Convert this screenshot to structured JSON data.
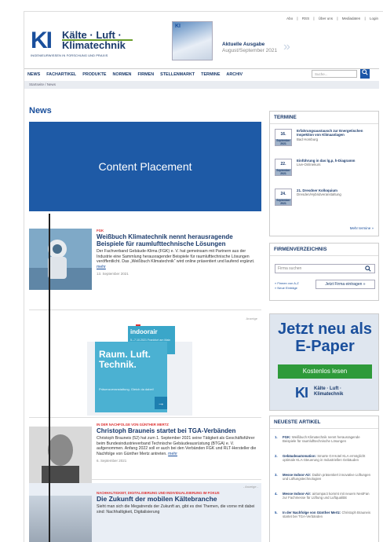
{
  "header": {
    "top_links": [
      "Abo",
      "RSS",
      "Über uns",
      "Mediadaten",
      "Login"
    ],
    "logo": {
      "ki": "KI",
      "line1": "Kälte · Luft ·",
      "line2": "Klimatechnik",
      "tagline": "INGENIEURWISSEN IN FORSCHUNG UND PRAXIS"
    },
    "magazine_title": "KI",
    "issue_label": "Aktuelle Ausgabe",
    "issue_date": "August/September 2021",
    "issue_arrow": "»"
  },
  "nav": {
    "items": [
      "NEWS",
      "FACHARTIKEL",
      "PRODUKTE",
      "NORMEN",
      "FIRMEN",
      "STELLENMARKT",
      "TERMINE",
      "ARCHIV"
    ],
    "search_placeholder": "Suche...",
    "search_icon": "search-icon"
  },
  "breadcrumb": "Startseite / News",
  "main": {
    "heading": "News",
    "content_placement": "Content Placement",
    "articles": [
      {
        "kicker": "FGK",
        "title": "Weißbuch Klimatechnik nennt herausragende Beispiele für raumlufttechnische Lösungen",
        "text": "Der Fachverband Gebäude-Klima (FGK) e. V. hat gemeinsam mit Partnern aus der Industrie eine Sammlung herausragender Beispiele für raumlufttechnische Lösungen veröffentlicht. Das „Weißbuch Klimatechnik“ wird online präsentiert und laufend ergänzt.",
        "more": "mehr",
        "date": "13. September 2021"
      },
      {
        "kicker": "IN DER NACHFOLGE VON GÜNTHER MERTZ",
        "title": "Christoph Brauneis startet bei TGA-Verbänden",
        "text": "Christoph Brauneis (52) hat zum 1. September 2021 seine Tätigkeit als Geschäftsführer beim Bundesindustrieverband Technische Gebäudeausrüstung (BTGA) e. V. aufgenommen. Anfang 2022 soll er auch bei den Verbänden FGK und RLT-Hersteller die Nachfolge von Günther Mertz antreten.",
        "more": "mehr",
        "date": "6. September 2021"
      }
    ],
    "ad_label": "Anzeige",
    "ad": {
      "brand": "indoorair",
      "brand_sub": "5.–7.10.2021 Frankfurt am Main",
      "headline": "Raum. Luft. Technik.",
      "sub": "Präsenzveranstaltung. Gleich da dabei!",
      "arrow": "→"
    },
    "ad3": {
      "label": "- Anzeige -",
      "kicker": "NACHHALTIGKEIT, DIGITALISIERUNG UND INDIVIDUALISIERUNG IM FOKUS",
      "title": "Die Zukunft der mobilen Kältebranche",
      "text": "Sieht man sich die Megatrends der Zukunft an, gibt es drei Themen, die vorne mit dabei sind: Nachhaltigkeit, Digitalisierung"
    }
  },
  "sidebar": {
    "termine": {
      "heading": "TERMINE",
      "items": [
        {
          "day": "16.",
          "month": "September 2021",
          "title": "Erfahrungsaustausch zur Energetischen Inspektion von Klimaanlagen",
          "place": "Bad Homburg"
        },
        {
          "day": "22.",
          "month": "September 2021",
          "title": "Einführung in das lg,p, h-Diagramm",
          "place": "Live-Onlinekurs"
        },
        {
          "day": "24.",
          "month": "September 2021",
          "title": "21. Dresdner Kolloquium",
          "place": "Dresden/Hybridveranstaltung"
        }
      ],
      "more": "Mehr termine »"
    },
    "firmen": {
      "heading": "FIRMENVERZEICHNIS",
      "placeholder": "Firma suchen",
      "links": [
        "» Firmen von A-Z",
        "» Neue Einträge"
      ],
      "button": "Jetzt Firma eintragen »"
    },
    "epaper": {
      "title": "Jetzt neu als E-Paper",
      "button": "Kostenlos lesen",
      "logo_ki": "KI",
      "logo_t1": "Kälte · Luft ·",
      "logo_t2": "Klimatechnik"
    },
    "neueste": {
      "heading": "NEUESTE ARTIKEL",
      "items": [
        {
          "n": "1.",
          "b": "FGK:",
          "t": "Weißbuch Klimatechnik nennt herausragende Beispiele für raumlufttechnische Lösungen"
        },
        {
          "n": "2.",
          "b": "Gebäudeautomation:",
          "t": "Smarte GI-Hotel KLA ermöglicht optimale KLA-Steuerung in Industriellen Gebäuden"
        },
        {
          "n": "3.",
          "b": "Messe Indoor-Air:",
          "t": "Daikin präsentiert innovative Lüftungen und Lüftungstechnologien"
        },
        {
          "n": "4.",
          "b": "Messe Indoor-Air:",
          "t": "airtompact kommt mit neuem NestFan zur Fachmesse für Lüftung und Luftqualität"
        },
        {
          "n": "5.",
          "b": "In der Nachfolge von Günther Mertz:",
          "t": "Christoph Brauneis startet bei TGA-Verbänden"
        }
      ]
    }
  }
}
